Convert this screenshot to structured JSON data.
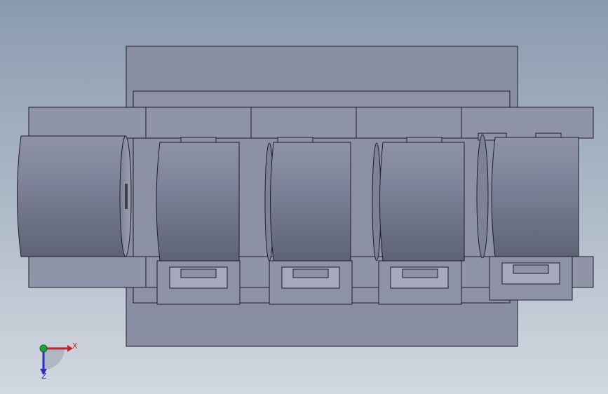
{
  "viewport": {
    "background_top": "#8a9aae",
    "background_bottom": "#d2d8e0"
  },
  "model": {
    "colors": {
      "plate": "#8a8ea3",
      "plate_light": "#9497ab",
      "edge": "#1e1e28",
      "cyl_dark": "#6a6e82",
      "cyl_light": "#a2a6b8",
      "clip": "#8e92a6",
      "slot": "#a6aabd"
    }
  },
  "triad": {
    "x_label": "X",
    "z_label": "Z",
    "x_color": "#c0262a",
    "y_color": "#1fa43a",
    "z_color": "#2a2fbf"
  }
}
